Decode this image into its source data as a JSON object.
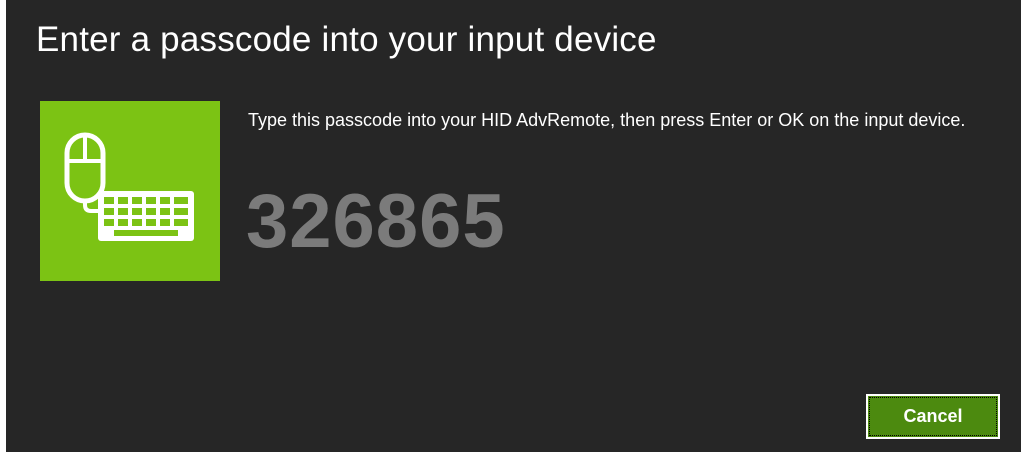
{
  "dialog": {
    "title": "Enter a passcode into your input device",
    "instruction": "Type this passcode into your HID AdvRemote, then press Enter or OK on the input device.",
    "passcode": "326865",
    "cancel_label": "Cancel",
    "tile_icon": "mouse-keyboard-icon"
  },
  "colors": {
    "background": "#262626",
    "tile": "#7cc314",
    "passcode": "#7b7b7b",
    "button": "#4c8a0f",
    "text": "#ffffff"
  }
}
